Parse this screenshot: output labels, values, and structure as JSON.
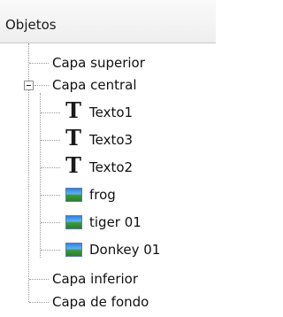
{
  "panel": {
    "title": "Objetos"
  },
  "tree": {
    "items": [
      {
        "label": "Capa superior",
        "level": 0,
        "icon": "none",
        "expanded": null
      },
      {
        "label": "Capa central",
        "level": 0,
        "icon": "none",
        "expanded": true
      },
      {
        "label": "Texto1",
        "level": 1,
        "icon": "text-object-icon"
      },
      {
        "label": "Texto3",
        "level": 1,
        "icon": "text-object-icon"
      },
      {
        "label": "Texto2",
        "level": 1,
        "icon": "text-object-icon"
      },
      {
        "label": "frog",
        "level": 1,
        "icon": "image-object-icon"
      },
      {
        "label": "tiger 01",
        "level": 1,
        "icon": "image-object-icon"
      },
      {
        "label": "Donkey 01",
        "level": 1,
        "icon": "image-object-icon"
      },
      {
        "label": "Capa inferior",
        "level": 0,
        "icon": "none",
        "expanded": null
      },
      {
        "label": "Capa de fondo",
        "level": 0,
        "icon": "none",
        "expanded": null
      }
    ]
  },
  "colors": {
    "header_bg": "#f2f2f2",
    "connector": "#9a9a9a",
    "text": "#111111"
  }
}
